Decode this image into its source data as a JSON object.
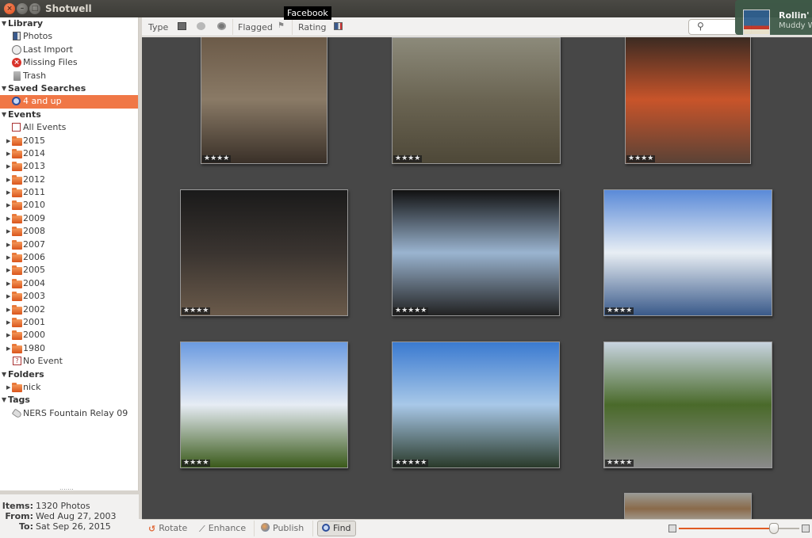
{
  "window": {
    "title": "Shotwell"
  },
  "sidebar": {
    "library": {
      "label": "Library",
      "items": [
        {
          "label": "Photos",
          "icon": "photos-icon"
        },
        {
          "label": "Last Import",
          "icon": "last-import-icon"
        },
        {
          "label": "Missing Files",
          "icon": "missing-files-icon"
        },
        {
          "label": "Trash",
          "icon": "trash-icon"
        }
      ]
    },
    "saved_searches": {
      "label": "Saved Searches",
      "items": [
        {
          "label": "4 and up",
          "icon": "saved-search-icon",
          "selected": true
        }
      ]
    },
    "events": {
      "label": "Events",
      "all_events": "All Events",
      "years": [
        "2015",
        "2014",
        "2013",
        "2012",
        "2011",
        "2010",
        "2009",
        "2008",
        "2007",
        "2006",
        "2005",
        "2004",
        "2003",
        "2002",
        "2001",
        "2000",
        "1980"
      ],
      "no_event": "No Event"
    },
    "folders": {
      "label": "Folders",
      "items": [
        "nick"
      ]
    },
    "tags": {
      "label": "Tags",
      "items": [
        "NERS Fountain Relay 09"
      ]
    }
  },
  "info": {
    "items_label": "Items:",
    "items_value": "1320 Photos",
    "from_label": "From:",
    "from_value": "Wed Aug 27, 2003",
    "to_label": "To:",
    "to_value": "Sat Sep 26, 2015"
  },
  "searchbar": {
    "type_label": "Type",
    "flagged_label": "Flagged",
    "rating_label": "Rating",
    "search_placeholder": "",
    "tooltip": "Facebook"
  },
  "notification": {
    "title": "Rollin' S",
    "subtitle": "Muddy W"
  },
  "photos": [
    {
      "desc": "Wooden trestle in forest",
      "rating": 4,
      "colors": [
        "#6b5a48",
        "#8a7a66",
        "#3a3028"
      ]
    },
    {
      "desc": "Forest trail with tall trees",
      "rating": 4,
      "colors": [
        "#8c8a7a",
        "#6a6452",
        "#4e4838"
      ]
    },
    {
      "desc": "Red mushroom close-up",
      "rating": 4,
      "colors": [
        "#3a2a22",
        "#c8542a",
        "#5a4236"
      ]
    },
    {
      "desc": "People on boat at night",
      "rating": 4,
      "colors": [
        "#1a1a1a",
        "#3a3430",
        "#6a5a4a"
      ]
    },
    {
      "desc": "Seattle skyline from ferry",
      "rating": 5,
      "colors": [
        "#111111",
        "#9ab4d0",
        "#222222"
      ]
    },
    {
      "desc": "Seattle skyline over water",
      "rating": 4,
      "colors": [
        "#5a8ad8",
        "#e8eef4",
        "#3a5a8a"
      ]
    },
    {
      "desc": "Green field with clouds",
      "rating": 4,
      "colors": [
        "#6a9ae0",
        "#e6ecf4",
        "#3a5a1a"
      ]
    },
    {
      "desc": "Waterfront view with blue sky",
      "rating": 5,
      "colors": [
        "#3a7ad0",
        "#a8c8e8",
        "#2a3a2a"
      ]
    },
    {
      "desc": "Shuffleboard game",
      "rating": 4,
      "colors": [
        "#c8d4e0",
        "#4a6a2a",
        "#8a8a8a"
      ]
    },
    {
      "desc": "Rusty weathered surface",
      "rating": 0,
      "colors": [
        "#9a9a94",
        "#8a6a4a",
        "#a8a8a2"
      ]
    }
  ],
  "toolbar": {
    "rotate_label": "Rotate",
    "enhance_label": "Enhance",
    "publish_label": "Publish",
    "find_label": "Find",
    "zoom_value": 0.79
  },
  "colors": {
    "accent": "#f07746",
    "slider_fill": "#e05a22",
    "grid_bg": "#474747"
  }
}
